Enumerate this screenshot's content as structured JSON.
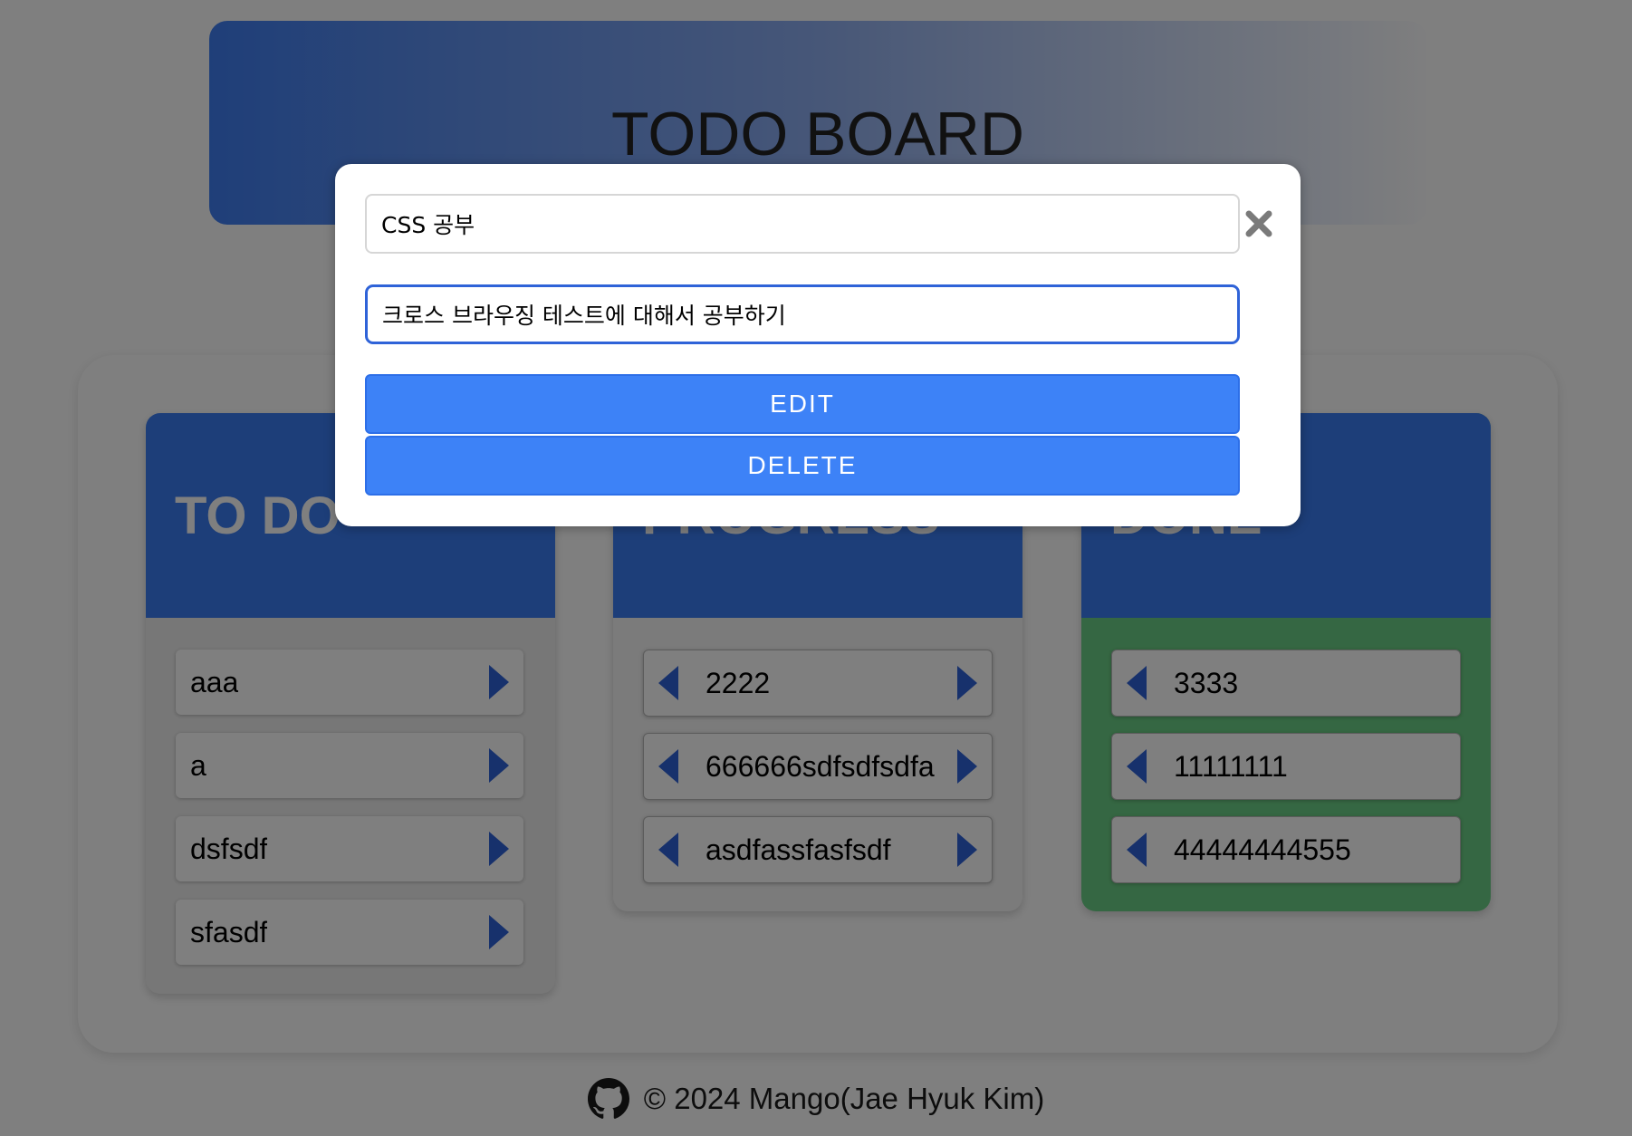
{
  "header": {
    "title": "TODO BOARD",
    "gradient_colors": [
      "#3f7ef2",
      "#8eaef0",
      "#fdfdfe"
    ]
  },
  "columns": [
    {
      "title": "TO DO",
      "cards": [
        "aaa",
        "a",
        "dsfsdf",
        "sfasdf"
      ],
      "has_left_arrow": false,
      "has_right_arrow": true
    },
    {
      "title": "PROGRESS",
      "cards": [
        "2222",
        "666666sdfsdfsdfa",
        "asdfassfasfsdf"
      ],
      "has_left_arrow": true,
      "has_right_arrow": true
    },
    {
      "title": "DONE",
      "cards": [
        "3333",
        "11111111",
        "44444444555"
      ],
      "has_left_arrow": true,
      "has_right_arrow": false
    }
  ],
  "modal": {
    "title_value": "CSS 공부",
    "description_value": "크로스 브라우징 테스트에 대해서 공부하기",
    "edit_label": "EDIT",
    "delete_label": "DELETE",
    "close_icon": "close-x-icon"
  },
  "footer": {
    "icon": "github-icon",
    "text": "© 2024 Mango(Jae Hyuk Kim)"
  },
  "colors": {
    "accent_blue": "#3a7cf3",
    "button_blue": "#3d82f7",
    "arrow_blue": "#2f63d8",
    "done_green": "#6bcf86",
    "overlay": "rgba(0,0,0,0.5)"
  }
}
